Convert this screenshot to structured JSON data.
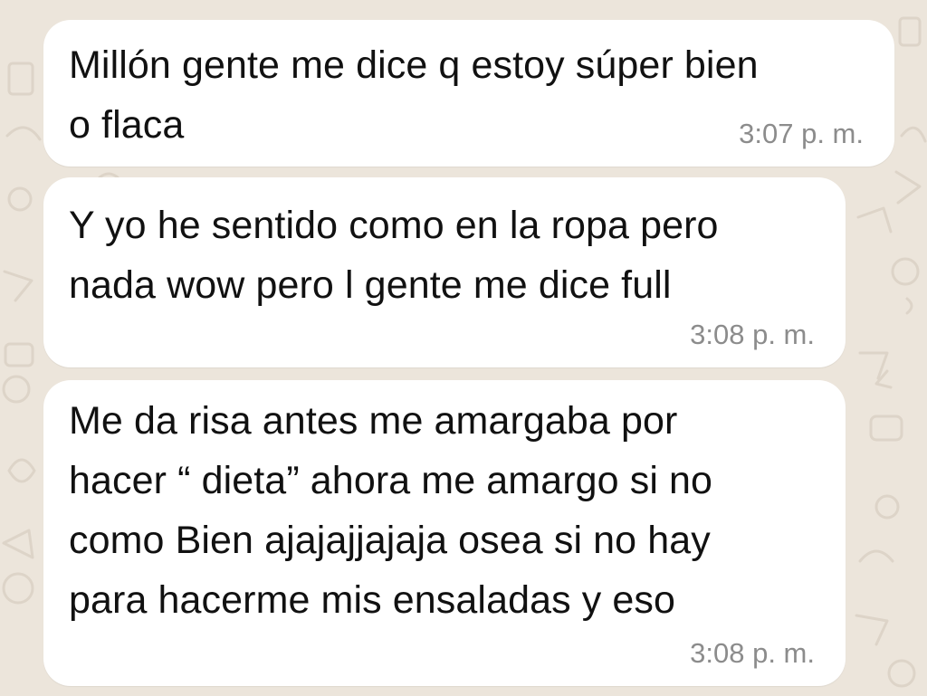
{
  "chat": {
    "wallpaper_color": "#ece5db",
    "bubble_color": "#ffffff",
    "messages": [
      {
        "text": "Millón gente me dice q estoy súper bien\no flaca",
        "time": "3:07 p. m."
      },
      {
        "text": "Y yo he sentido como en la ropa pero\nnada wow pero l gente me dice full",
        "time": "3:08 p. m."
      },
      {
        "text": "Me da risa antes me amargaba por\nhacer “ dieta” ahora me amargo si no\ncomo Bien ajajajjajaja osea si no hay\npara hacerme mis ensaladas y eso",
        "time": "3:08 p. m."
      }
    ]
  }
}
